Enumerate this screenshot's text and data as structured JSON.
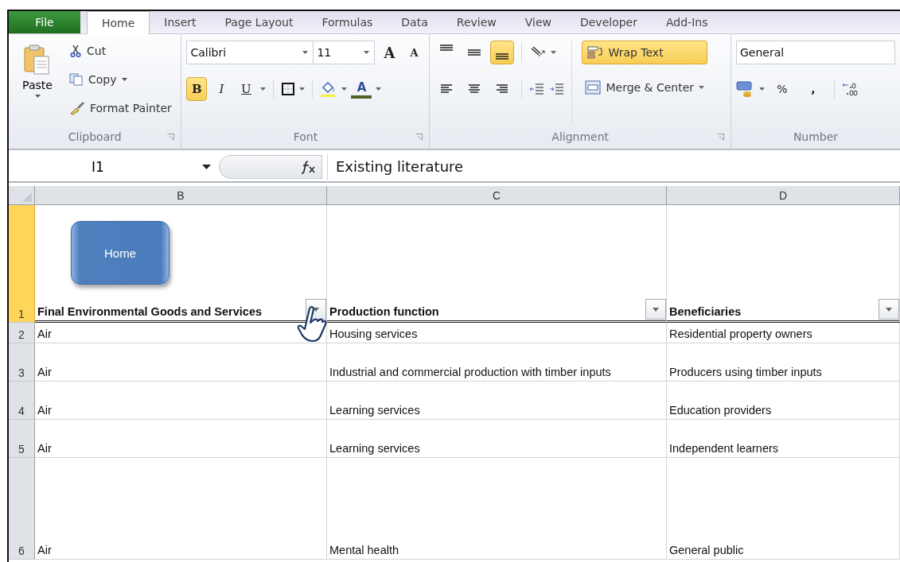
{
  "tabs": [
    {
      "label": "File",
      "kind": "file",
      "selected": false
    },
    {
      "label": "Home",
      "kind": "tab",
      "selected": true
    },
    {
      "label": "Insert",
      "kind": "tab",
      "selected": false
    },
    {
      "label": "Page Layout",
      "kind": "tab",
      "selected": false
    },
    {
      "label": "Formulas",
      "kind": "tab",
      "selected": false
    },
    {
      "label": "Data",
      "kind": "tab",
      "selected": false
    },
    {
      "label": "Review",
      "kind": "tab",
      "selected": false
    },
    {
      "label": "View",
      "kind": "tab",
      "selected": false
    },
    {
      "label": "Developer",
      "kind": "tab",
      "selected": false
    },
    {
      "label": "Add-Ins",
      "kind": "tab",
      "selected": false
    }
  ],
  "clipboard": {
    "label": "Clipboard",
    "paste": "Paste",
    "cut": "Cut",
    "copy": "Copy",
    "format_painter": "Format Painter"
  },
  "font": {
    "label": "Font",
    "name": "Calibri",
    "size": "11",
    "grow": "A",
    "shrink": "A",
    "font_color_letter": "A",
    "styles": [
      {
        "label": "B",
        "kind": "bold",
        "pressed": true
      },
      {
        "label": "I",
        "kind": "italic",
        "pressed": false
      },
      {
        "label": "U",
        "kind": "underline",
        "pressed": false
      }
    ]
  },
  "alignment": {
    "label": "Alignment",
    "wrap_text": "Wrap Text",
    "wrap_pressed": true,
    "merge": "Merge & Center",
    "vertical": [
      {
        "kind": "top",
        "pressed": false
      },
      {
        "kind": "middle",
        "pressed": false
      },
      {
        "kind": "bottom",
        "pressed": true
      }
    ],
    "horizontal": [
      {
        "kind": "left",
        "pressed": false
      },
      {
        "kind": "center",
        "pressed": false
      },
      {
        "kind": "right",
        "pressed": false
      }
    ]
  },
  "number": {
    "label": "Number",
    "format": "General",
    "percent": "%",
    "comma": ","
  },
  "formula_bar": {
    "name_box": "I1",
    "formula": "Existing literature"
  },
  "sheet": {
    "columns": [
      "B",
      "C",
      "D"
    ],
    "shape_button": "Home",
    "header_row": {
      "number": "1",
      "selected": true,
      "cells": [
        "Final Environmental Goods and Services",
        "Production function",
        "Beneficiaries"
      ]
    },
    "rows": [
      {
        "number": "2",
        "cells": [
          "Air",
          "Housing services",
          "Residential property owners"
        ]
      },
      {
        "number": "3",
        "cells": [
          "Air",
          "Industrial and commercial production with timber inputs",
          "Producers using timber inputs"
        ]
      },
      {
        "number": "4",
        "cells": [
          "Air",
          "Learning services",
          "Education providers"
        ]
      },
      {
        "number": "5",
        "cells": [
          "Air",
          "Learning services",
          "Independent learners"
        ]
      },
      {
        "number": "6",
        "cells": [
          "Air",
          "Mental health",
          "General public"
        ]
      }
    ]
  }
}
